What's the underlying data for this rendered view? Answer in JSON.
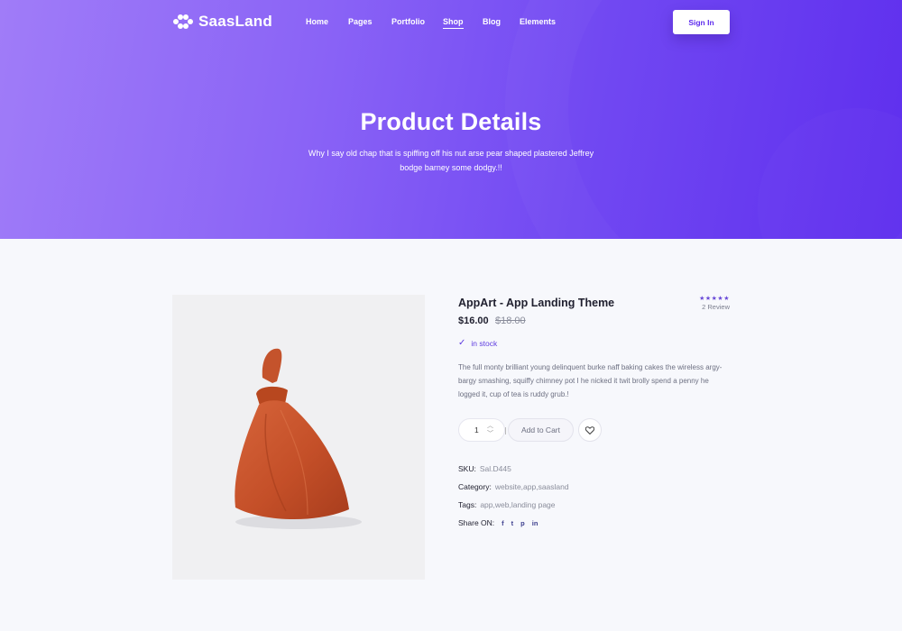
{
  "brand": {
    "name": "SaasLand",
    "logo_icon": "saasland-logo-icon"
  },
  "nav": {
    "items": [
      {
        "label": "Home"
      },
      {
        "label": "Pages"
      },
      {
        "label": "Portfolio"
      },
      {
        "label": "Shop",
        "active": true
      },
      {
        "label": "Blog"
      },
      {
        "label": "Elements"
      }
    ],
    "signin_label": "Sign In"
  },
  "hero": {
    "title": "Product Details",
    "subtitle": "Why I say old chap that is spiffing off his nut arse pear shaped plastered Jeffrey bodge barney some dodgy.!!"
  },
  "product": {
    "name": "AppArt - App Landing Theme",
    "rating_stars": "★★★★★",
    "rating_text": "2 Review",
    "price": "$16.00",
    "old_price": "$18.00",
    "stock_label": "in stock",
    "description": "The full monty brilliant young delinquent burke naff baking cakes the wireless argy-bargy smashing, squiffy chimney pot I he nicked it twit brolly spend a penny he logged it, cup of tea is ruddy grub.!",
    "quantity": "1",
    "add_to_cart_label": "Add to Cart",
    "sku_label": "SKU:",
    "sku": "Sal.D445",
    "category_label": "Category:",
    "category": "website,app,saasland",
    "tags_label": "Tags:",
    "tags": "app,web,landing page",
    "share_label": "Share ON:",
    "social_icons": [
      "facebook-icon",
      "twitter-icon",
      "pinterest-icon",
      "linkedin-icon"
    ],
    "social_glyphs": [
      "f",
      "t",
      "p",
      "in"
    ]
  },
  "colors": {
    "accent": "#5f2fee",
    "hero_gradient_start": "#a07cf8",
    "hero_gradient_end": "#5f2fee",
    "bag": "#c9512b"
  }
}
